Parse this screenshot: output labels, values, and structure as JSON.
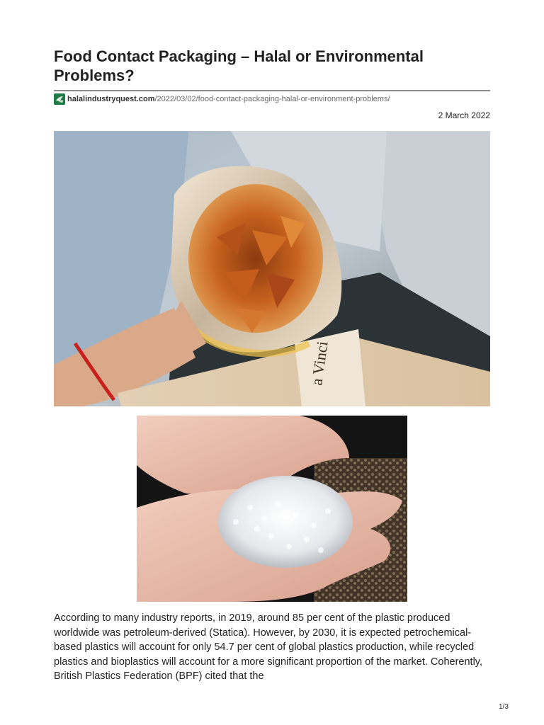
{
  "article": {
    "title": "Food Contact Packaging – Halal or Environmental Problems?",
    "source_domain": "halalindustryquest.com",
    "source_path": "/2022/03/02/food-contact-packaging-halal-or-environment-problems/",
    "date": "2 March 2022",
    "paragraph": "According to many industry reports, in 2019, around 85 per cent of the plastic produced worldwide was petroleum-derived (Statica). However, by 2030, it is expected petrochemical-based plastics will account for only 54.7 per cent of global plastics production, while recycled plastics and bioplastics will account for a more significant proportion of the market. Coherently, British Plastics Federation (BPF) cited that the"
  },
  "images": {
    "photo1_book_text": "a Vinci"
  },
  "footer": {
    "page_number": "1/3"
  },
  "icons": {
    "favicon": "site-logo-icon"
  },
  "colors": {
    "favicon_bg": "#1d7a46",
    "rule": "#8c8c8c",
    "text": "#222222"
  }
}
